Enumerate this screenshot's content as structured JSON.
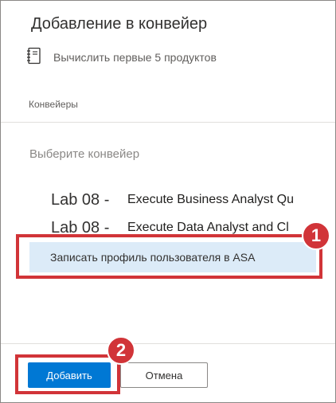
{
  "dialog": {
    "title": "Добавление в конвейер",
    "notebook_name": "Вычислить первые 5 продуктов",
    "section_label": "Конвейеры",
    "select_placeholder": "Выберите конвейер"
  },
  "pipelines": [
    {
      "prefix": "Lab 08 -",
      "name": "Execute Business Analyst Qu"
    },
    {
      "prefix": "Lab 08 -",
      "name": "Execute Data Analyst and Cl"
    }
  ],
  "highlighted_option": "Записать профиль пользователя в ASA",
  "callouts": [
    "1",
    "2"
  ],
  "buttons": {
    "add": "Добавить",
    "cancel": "Отмена"
  },
  "colors": {
    "primary": "#0078d4",
    "highlight": "#dcebf8",
    "callout_red": "#d13438"
  },
  "icons": {
    "notebook": "notebook-icon"
  }
}
